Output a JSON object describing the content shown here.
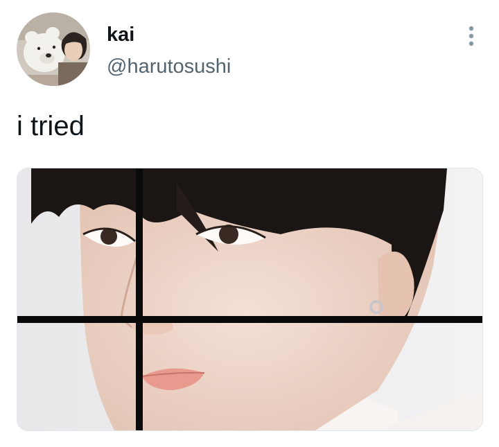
{
  "tweet": {
    "author": {
      "display_name": "kai",
      "handle": "@harutosushi",
      "avatar_icon": "avatar-photo"
    },
    "more_icon": "more-vertical-icon",
    "text": "i tried",
    "media": {
      "type": "photo"
    }
  },
  "colors": {
    "primary_text": "#0f1419",
    "secondary_text": "#536471",
    "background": "#ffffff"
  }
}
